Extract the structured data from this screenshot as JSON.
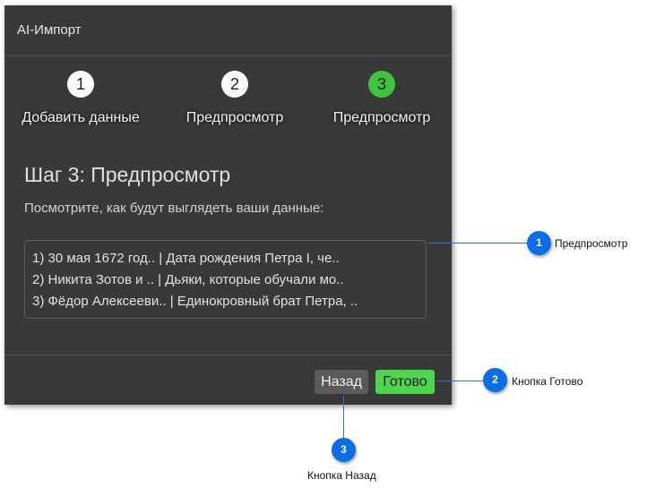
{
  "dialog": {
    "title": "AI-Импорт",
    "steps": [
      {
        "number": "1",
        "label": "Добавить данные"
      },
      {
        "number": "2",
        "label": "Предпросмотр"
      },
      {
        "number": "3",
        "label": "Предпросмотр"
      }
    ],
    "active_step": 3,
    "heading": "Шаг 3: Предпросмотр",
    "description": "Посмотрите, как будут выглядеть ваши данные:",
    "preview_rows": [
      "1) 30 мая 1672 год.. | Дата рождения Петра I, че..",
      "2) Никита Зотов и .. | Дьяки, которые обучали мо..",
      "3) Фёдор Алексееви.. | Единокровный брат Петра, .."
    ],
    "buttons": {
      "back": "Назад",
      "done": "Готово"
    }
  },
  "callouts": [
    {
      "number": "1",
      "label": "Предпросмотр"
    },
    {
      "number": "2",
      "label": "Кнопка Готово"
    },
    {
      "number": "3",
      "label": "Кнопка Назад"
    }
  ],
  "colors": {
    "dialog_bg": "#393939",
    "active_step": "#3ec43e",
    "done_button": "#4fd64f",
    "callout_marker": "#0a6ee8"
  }
}
